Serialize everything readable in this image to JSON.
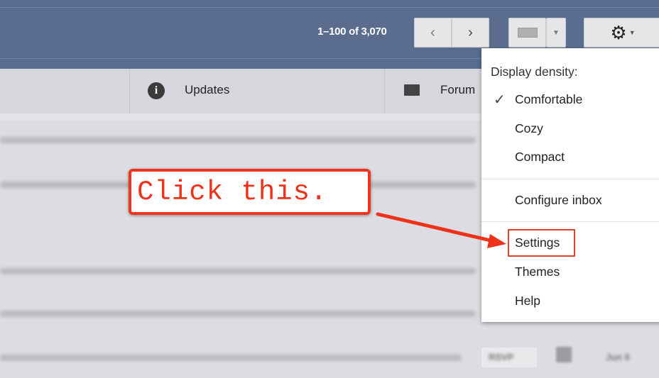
{
  "header": {
    "pagination": "1–100 of 3,070",
    "prev_icon": "chevron-left-icon",
    "next_icon": "chevron-right-icon",
    "keyboard_icon": "keyboard-icon",
    "settings_icon": "gear-icon"
  },
  "tabs": [
    {
      "label": "Updates",
      "icon": "info-icon"
    },
    {
      "label": "Forum",
      "icon": "forum-chat-icon"
    }
  ],
  "menu": {
    "section_label": "Display density:",
    "density_options": [
      {
        "label": "Comfortable",
        "checked": true
      },
      {
        "label": "Cozy",
        "checked": false
      },
      {
        "label": "Compact",
        "checked": false
      }
    ],
    "configure_inbox": "Configure inbox",
    "settings": "Settings",
    "themes": "Themes",
    "help": "Help"
  },
  "annotation": {
    "callout_text": "Click this.",
    "accent_color": "#ee3118"
  },
  "email_row": {
    "rsvp": "RSVP",
    "date": "Jun 6"
  }
}
